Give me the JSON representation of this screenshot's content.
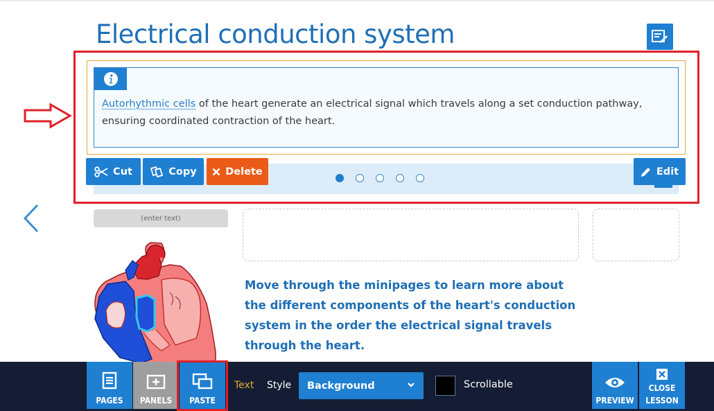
{
  "page": {
    "title": "Electrical conduction system",
    "edit_page_icon": "edit-page-icon"
  },
  "info_box": {
    "icon": "info-icon",
    "link_text": "Autorhythmic cells",
    "body_text": " of the heart generate an electrical signal which travels along a set conduction pathway, ensuring coordinated contraction of the heart."
  },
  "toolbar": {
    "cut_label": "Cut",
    "copy_label": "Copy",
    "delete_label": "Delete",
    "edit_label": "Edit"
  },
  "pagination": {
    "total": 5,
    "active": 1
  },
  "content": {
    "enter_text_placeholder": "(enter text)",
    "description": "Move through the minipages to learn more about the different components of the heart's conduction system in the order the electrical signal travels through the heart."
  },
  "bottom_bar": {
    "pages_label": "PAGES",
    "panels_label": "PANELS",
    "paste_label": "PASTE",
    "text_label": "Text",
    "style_label": "Style",
    "style_value": "Background",
    "scrollable_label": "Scrollable",
    "preview_label": "PREVIEW",
    "close_label_line1": "CLOSE",
    "close_label_line2": "LESSON"
  },
  "colors": {
    "accent": "#1f7fd1",
    "title": "#1f6fb5",
    "delete": "#ea5b18",
    "annotation": "#e0202a",
    "bottom_bar": "#141d33",
    "text_label": "#e5a83a"
  }
}
